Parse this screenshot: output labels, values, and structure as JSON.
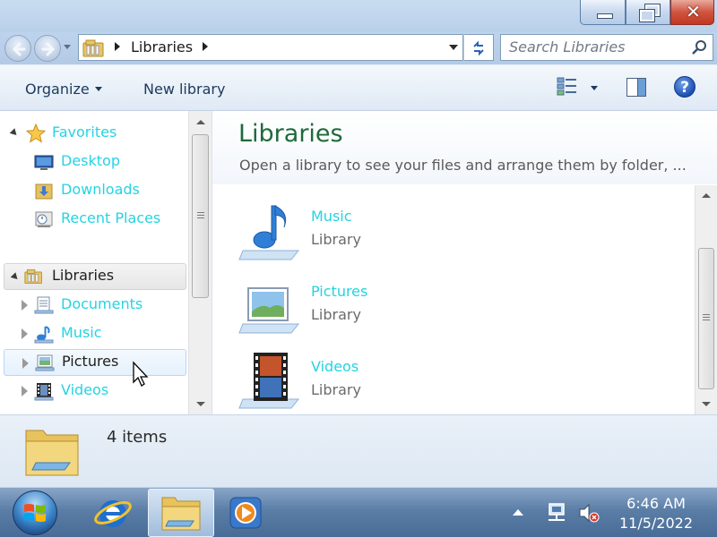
{
  "window": {
    "close_glyph": "✕"
  },
  "address": {
    "path": "Libraries",
    "search_placeholder": "Search Libraries"
  },
  "toolbar": {
    "organize_label": "Organize",
    "new_library_label": "New library",
    "help_glyph": "?"
  },
  "navpane": {
    "favorites": {
      "label": "Favorites",
      "items": [
        {
          "label": "Desktop",
          "icon": "desktop-icon"
        },
        {
          "label": "Downloads",
          "icon": "downloads-folder-icon"
        },
        {
          "label": "Recent Places",
          "icon": "recent-places-icon"
        }
      ]
    },
    "libraries": {
      "label": "Libraries",
      "items": [
        {
          "label": "Documents",
          "icon": "documents-library-icon"
        },
        {
          "label": "Music",
          "icon": "music-library-icon"
        },
        {
          "label": "Pictures",
          "icon": "pictures-library-icon"
        },
        {
          "label": "Videos",
          "icon": "videos-library-icon"
        }
      ]
    }
  },
  "content": {
    "title": "Libraries",
    "subtitle": "Open a library to see your files and arrange them by folder, ...",
    "items": [
      {
        "name": "Music",
        "type": "Library",
        "icon": "music-note-icon"
      },
      {
        "name": "Pictures",
        "type": "Library",
        "icon": "picture-frame-icon"
      },
      {
        "name": "Videos",
        "type": "Library",
        "icon": "film-strip-icon"
      }
    ]
  },
  "details": {
    "item_count": "4 items"
  },
  "taskbar": {
    "apps": [
      "internet-explorer-icon",
      "windows-explorer-icon",
      "media-player-icon"
    ],
    "clock": {
      "time": "6:46 AM",
      "date": "11/5/2022"
    }
  },
  "colors": {
    "link": "#25d3e2",
    "title_green": "#1e6a39",
    "close_red": "#c13820"
  }
}
